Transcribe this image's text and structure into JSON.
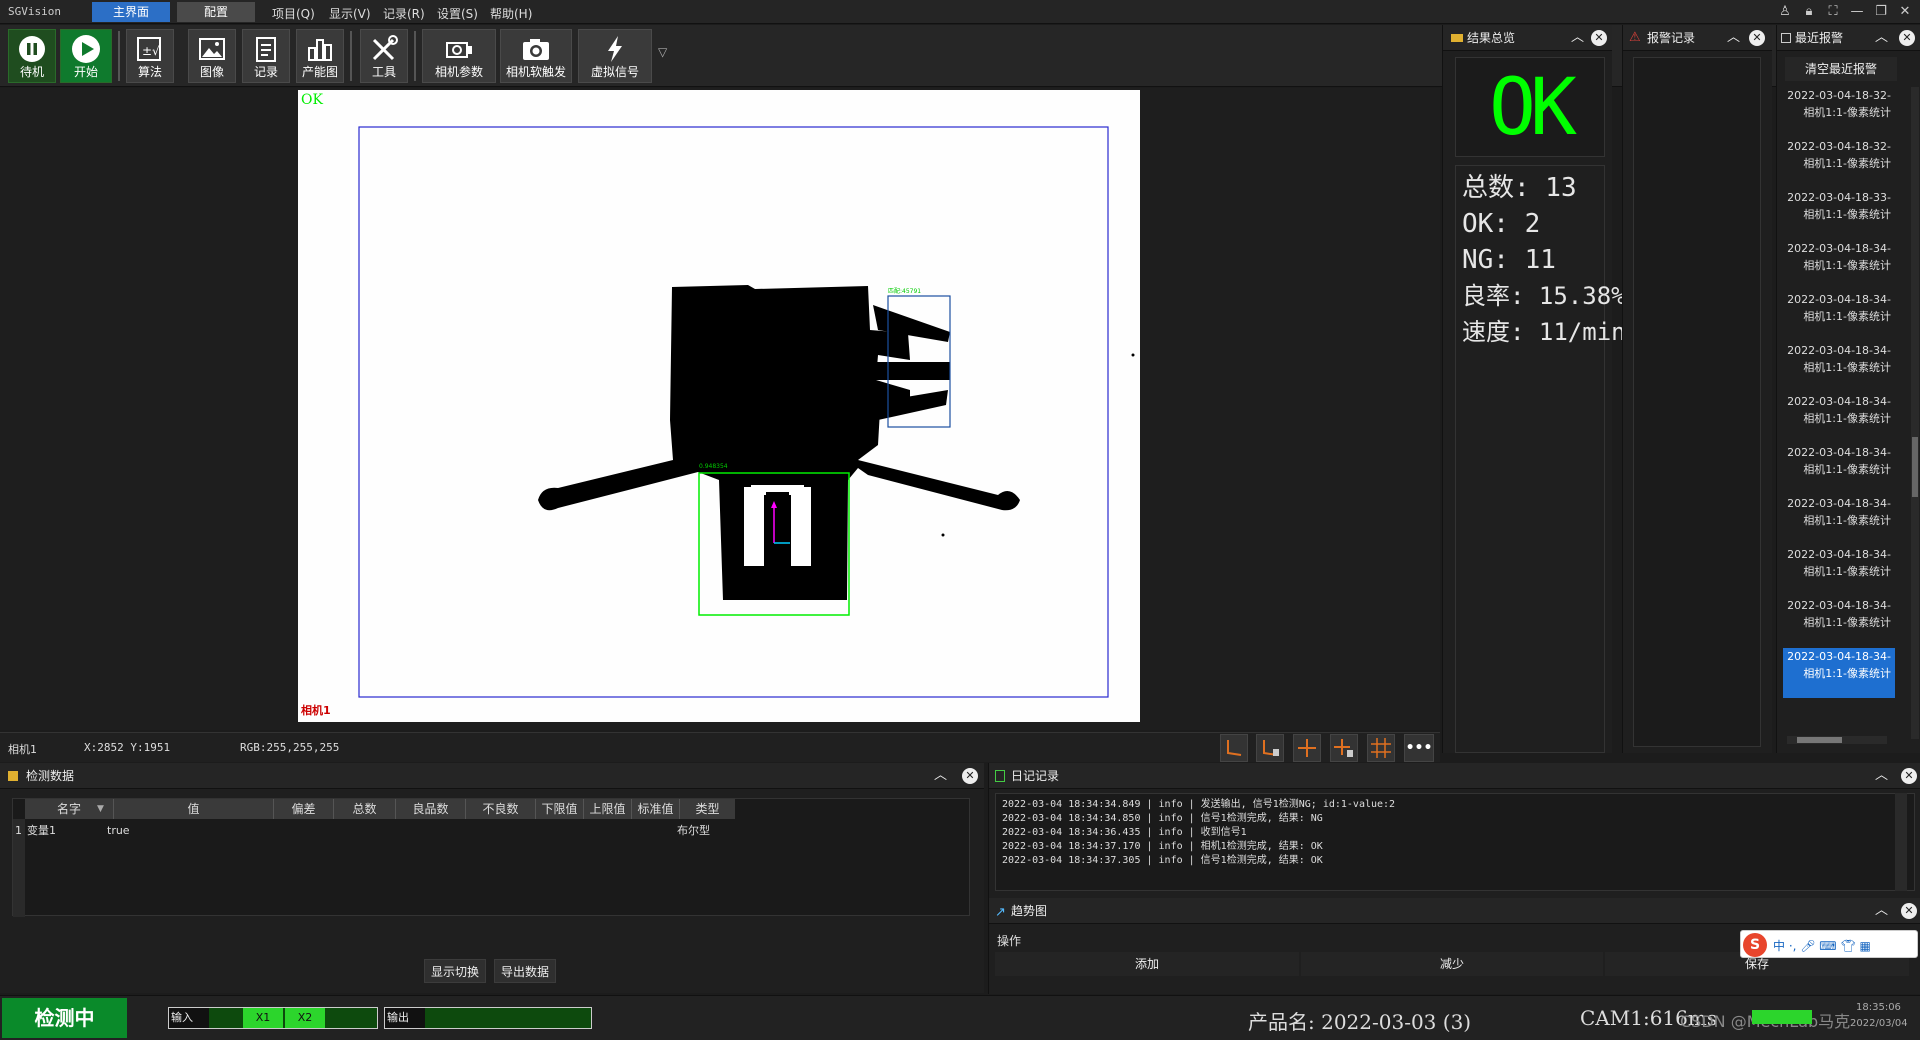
{
  "app": {
    "title": "SGVision",
    "tabs": [
      {
        "label": "主界面"
      },
      {
        "label": "配置"
      }
    ],
    "menu": [
      "项目(Q)",
      "显示(V)",
      "记录(R)",
      "设置(S)",
      "帮助(H)"
    ]
  },
  "toolbar": {
    "standby": "待机",
    "start": "开始",
    "algorithm": "算法",
    "image": "图像",
    "record": "记录",
    "capacity": "产能图",
    "tools": "工具",
    "camera_params": "相机参数",
    "camera_trigger": "相机软触发",
    "virtual_signal": "虚拟信号"
  },
  "view": {
    "result_label": "OK",
    "camera_label": "相机1",
    "roi1_text": "匹配:45791",
    "roi2_text": "0.948354"
  },
  "status": {
    "camera": "相机1",
    "coords": "X:2852 Y:1951",
    "rgb": "RGB:255,255,255"
  },
  "result_panel": {
    "title": "结果总览",
    "result": "OK",
    "total": "总数:  13",
    "ok": "OK:  2",
    "ng": "NG:  11",
    "yield": "良率:  15.38%",
    "speed": "速度:  11/min"
  },
  "alarm_panel": {
    "title": "报警记录"
  },
  "recent_alarm": {
    "title": "最近报警",
    "clear_btn": "清空最近报警",
    "items": [
      {
        "time": "2022-03-04-18-32-",
        "msg": "相机1:1-像素统计"
      },
      {
        "time": "2022-03-04-18-32-",
        "msg": "相机1:1-像素统计"
      },
      {
        "time": "2022-03-04-18-33-",
        "msg": "相机1:1-像素统计"
      },
      {
        "time": "2022-03-04-18-34-",
        "msg": "相机1:1-像素统计"
      },
      {
        "time": "2022-03-04-18-34-",
        "msg": "相机1:1-像素统计"
      },
      {
        "time": "2022-03-04-18-34-",
        "msg": "相机1:1-像素统计"
      },
      {
        "time": "2022-03-04-18-34-",
        "msg": "相机1:1-像素统计"
      },
      {
        "time": "2022-03-04-18-34-",
        "msg": "相机1:1-像素统计"
      },
      {
        "time": "2022-03-04-18-34-",
        "msg": "相机1:1-像素统计"
      },
      {
        "time": "2022-03-04-18-34-",
        "msg": "相机1:1-像素统计"
      },
      {
        "time": "2022-03-04-18-34-",
        "msg": "相机1:1-像素统计"
      },
      {
        "time": "2022-03-04-18-34-",
        "msg": "相机1:1-像素统计"
      }
    ]
  },
  "detect_data": {
    "title": "检测数据",
    "columns": [
      "名字",
      "值",
      "偏差",
      "总数",
      "良品数",
      "不良数",
      "下限值",
      "上限值",
      "标准值",
      "类型"
    ],
    "rows": [
      {
        "idx": "1",
        "name": "变量1",
        "value": "true",
        "type": "布尔型"
      }
    ],
    "btn_switch": "显示切换",
    "btn_export": "导出数据"
  },
  "log_panel": {
    "title": "日记记录",
    "lines": [
      "2022-03-04 18:34:34.849 | info | 发送输出, 信号1检测NG; id:1-value:2",
      "2022-03-04 18:34:34.850 | info | 信号1检测完成, 结果: NG",
      "2022-03-04 18:34:36.435 | info | 收到信号1",
      "2022-03-04 18:34:37.170 | info | 相机1检测完成, 结果: OK",
      "2022-03-04 18:34:37.305 | info | 信号1检测完成, 结果: OK"
    ]
  },
  "trend_panel": {
    "title": "趋势图",
    "op": "操作",
    "add": "添加",
    "reduce": "减少",
    "save": "保存"
  },
  "bottom": {
    "status": "检测中",
    "input_label": "输入",
    "x1": "X1",
    "x2": "X2",
    "output_label": "输出",
    "product": "产品名: 2022-03-03 (3)",
    "cam": "CAM1:616ms",
    "watermark": "CSDN @MechLab马克",
    "clock_time": "18:35:06",
    "clock_date": "2022/03/04"
  },
  "colors": {
    "ok_green": "#00ff00",
    "accent_blue": "#2c6fc6",
    "alarm_red": "#d9413a"
  }
}
